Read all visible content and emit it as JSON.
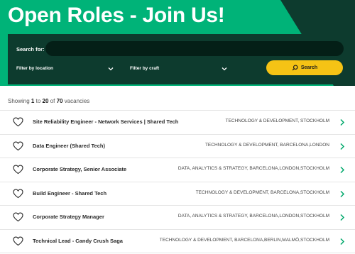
{
  "hero": {
    "title": "Open Roles - Join Us!",
    "colors": {
      "primary": "#00b378",
      "dark": "#0d3b2e",
      "accent": "#f5c315",
      "chevron": "#00a86b"
    }
  },
  "search": {
    "label": "Search for:",
    "value": "",
    "placeholder": "",
    "filter_location": "Filter by location",
    "filter_craft": "Filter by craft",
    "button_label": "Search",
    "button_icon": "search-icon"
  },
  "results": {
    "prefix": "Showing",
    "from": "1",
    "to_word": "to",
    "to": "20",
    "of_word": "of",
    "total": "70",
    "suffix": "vacancies"
  },
  "jobs": [
    {
      "title": "Site Reliability Engineer - Network Services | Shared Tech",
      "meta": "TECHNOLOGY & DEVELOPMENT, STOCKHOLM"
    },
    {
      "title": "Data Engineer (Shared Tech)",
      "meta": "TECHNOLOGY & DEVELOPMENT, BARCELONA,LONDON"
    },
    {
      "title": "Corporate Strategy, Senior Associate",
      "meta": "DATA, ANALYTICS & STRATEGY, BARCELONA,LONDON,STOCKHOLM"
    },
    {
      "title": "Build Engineer - Shared Tech",
      "meta": "TECHNOLOGY & DEVELOPMENT, BARCELONA,STOCKHOLM"
    },
    {
      "title": "Corporate Strategy Manager",
      "meta": "DATA, ANALYTICS & STRATEGY, BARCELONA,LONDON,STOCKHOLM"
    },
    {
      "title": "Technical Lead - Candy Crush Saga",
      "meta": "TECHNOLOGY & DEVELOPMENT, BARCELONA,BERLIN,MALMÖ,STOCKHOLM"
    }
  ]
}
